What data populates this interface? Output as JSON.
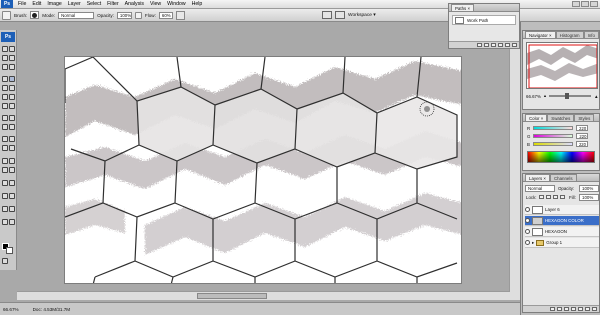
{
  "app": {
    "logo": "Ps"
  },
  "menubar": {
    "items": [
      "File",
      "Edit",
      "Image",
      "Layer",
      "Select",
      "Filter",
      "Analysis",
      "View",
      "Window",
      "Help"
    ]
  },
  "options": {
    "brush_label": "Brush:",
    "mode_label": "Mode:",
    "mode_value": "Normal",
    "opacity_label": "Opacity:",
    "opacity_value": "100%",
    "flow_label": "Flow:",
    "flow_value": "60%",
    "workspace_label": "Workspace ▾"
  },
  "paths_panel": {
    "tab": "Paths ×",
    "row_label": "Work Path"
  },
  "navigator": {
    "tabs": [
      "Navigator ×",
      "Histogram",
      "Info"
    ],
    "zoom": "66.67%"
  },
  "color_panel": {
    "tabs": [
      "Color ×",
      "Swatches",
      "Styles"
    ],
    "rows": [
      {
        "channel": "R",
        "value": "220"
      },
      {
        "channel": "G",
        "value": "220"
      },
      {
        "channel": "B",
        "value": "220"
      }
    ]
  },
  "layers_panel": {
    "tabs": [
      "Layers ×",
      "Channels"
    ],
    "blend_mode": "Normal",
    "opacity_label": "Opacity:",
    "opacity_value": "100%",
    "lock_label": "Lock:",
    "fill_label": "Fill:",
    "fill_value": "100%",
    "layers": [
      {
        "name": "Layer 6",
        "kind": "layer",
        "selected": false
      },
      {
        "name": "HEXAGON COLOR",
        "kind": "layer",
        "selected": true
      },
      {
        "name": "HEXAGON",
        "kind": "layer",
        "selected": false
      },
      {
        "name": "Group 1",
        "kind": "group",
        "selected": false
      }
    ]
  },
  "status": {
    "zoom": "66.67%",
    "doc": "Doc: 4.53M/31.7M"
  },
  "colors": {
    "ps_blue": "#1d5fb7",
    "selection": "#3a6ec8",
    "canvas_bg": "#ffffff",
    "smudge_gray": "#b9b4b6"
  }
}
